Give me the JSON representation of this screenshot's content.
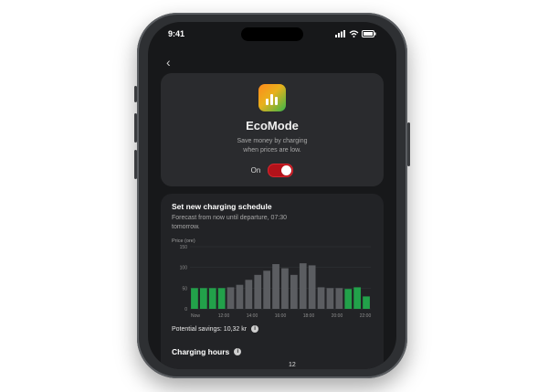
{
  "status_bar": {
    "time": "9:41"
  },
  "nav": {
    "back_icon": "chevron-left-icon",
    "back_glyph": "‹"
  },
  "app": {
    "icon": "bar-chart-app-icon",
    "title": "EcoMode",
    "subtitle_line1": "Save money by charging",
    "subtitle_line2": "when prices are low.",
    "toggle_label": "On",
    "toggle_on": true,
    "toggle_color": "#b3121a"
  },
  "schedule": {
    "title": "Set new charging schedule",
    "subtitle": "Forecast from now until departure, 07:30 tomorrow."
  },
  "chart_data": {
    "type": "bar",
    "ylabel": "Price (ore)",
    "yticks": [
      "150",
      "100",
      "50",
      "0"
    ],
    "ylim": [
      0,
      150
    ],
    "xticks": [
      "Now",
      "12:00",
      "14:00",
      "16:00",
      "18:00",
      "20:00",
      "22:00"
    ],
    "values": [
      50,
      50,
      50,
      50,
      52,
      58,
      70,
      82,
      92,
      108,
      98,
      82,
      110,
      105,
      52,
      50,
      50,
      48,
      52,
      30
    ],
    "charging": [
      true,
      true,
      true,
      true,
      false,
      false,
      false,
      false,
      false,
      false,
      false,
      false,
      false,
      false,
      false,
      false,
      false,
      true,
      true,
      true
    ],
    "colors": {
      "charging": "#22a14a",
      "idle": "#5b5d61"
    }
  },
  "savings": {
    "label": "Potential savings: 10,32 kr"
  },
  "hours": {
    "label": "Charging hours",
    "value": "12"
  }
}
